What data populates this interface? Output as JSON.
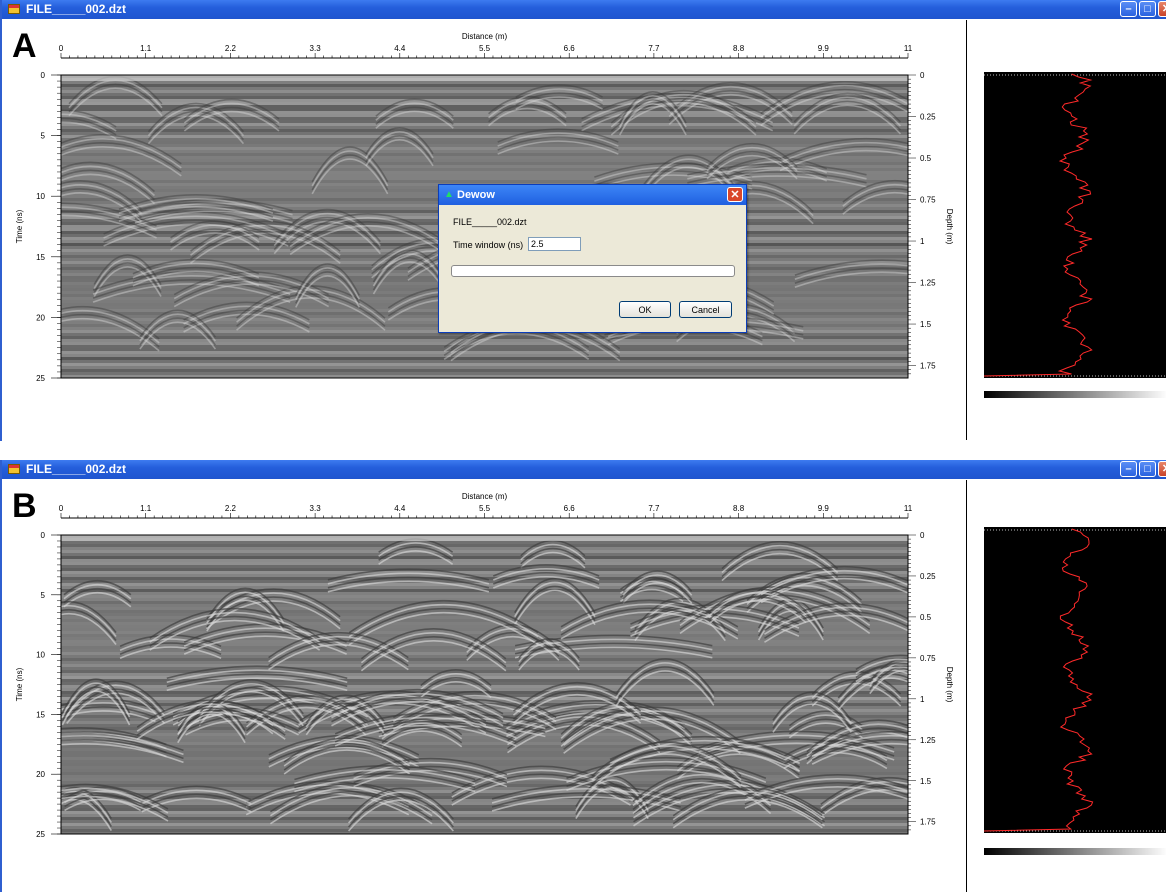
{
  "windows": [
    {
      "id": "A",
      "title": "FILE_____002.dzt",
      "panel_letter": "A",
      "x_axis": {
        "label": "Distance (m)",
        "ticks": [
          "0",
          "1.1",
          "2.2",
          "3.3",
          "4.4",
          "5.5",
          "6.6",
          "7.7",
          "8.8",
          "9.9",
          "11"
        ]
      },
      "y_axis_left": {
        "label": "Time (ns)",
        "ticks": [
          "0",
          "5",
          "10",
          "15",
          "20",
          "25"
        ]
      },
      "y_axis_right": {
        "label": "Depth (m)",
        "ticks": [
          "0",
          "0.25",
          "0.5",
          "0.75",
          "1",
          "1.25",
          "1.5",
          "1.75"
        ]
      }
    },
    {
      "id": "B",
      "title": "FILE_____002.dzt",
      "panel_letter": "B",
      "x_axis": {
        "label": "Distance (m)",
        "ticks": [
          "0",
          "1.1",
          "2.2",
          "3.3",
          "4.4",
          "5.5",
          "6.6",
          "7.7",
          "8.8",
          "9.9",
          "11"
        ]
      },
      "y_axis_left": {
        "label": "Time (ns)",
        "ticks": [
          "0",
          "5",
          "10",
          "15",
          "20",
          "25"
        ]
      },
      "y_axis_right": {
        "label": "Depth (m)",
        "ticks": [
          "0",
          "0.25",
          "0.5",
          "0.75",
          "1",
          "1.25",
          "1.5",
          "1.75"
        ]
      }
    }
  ],
  "dialog": {
    "title": "Dewow",
    "filename": "FILE_____002.dzt",
    "time_window_label": "Time window (ns)",
    "time_window_value": "2.5",
    "ok_label": "OK",
    "cancel_label": "Cancel",
    "progress": 0
  },
  "colors": {
    "titlebar": "#245edb",
    "trace_line": "#ff2a2a",
    "dialog_bg": "#ece9d8"
  }
}
